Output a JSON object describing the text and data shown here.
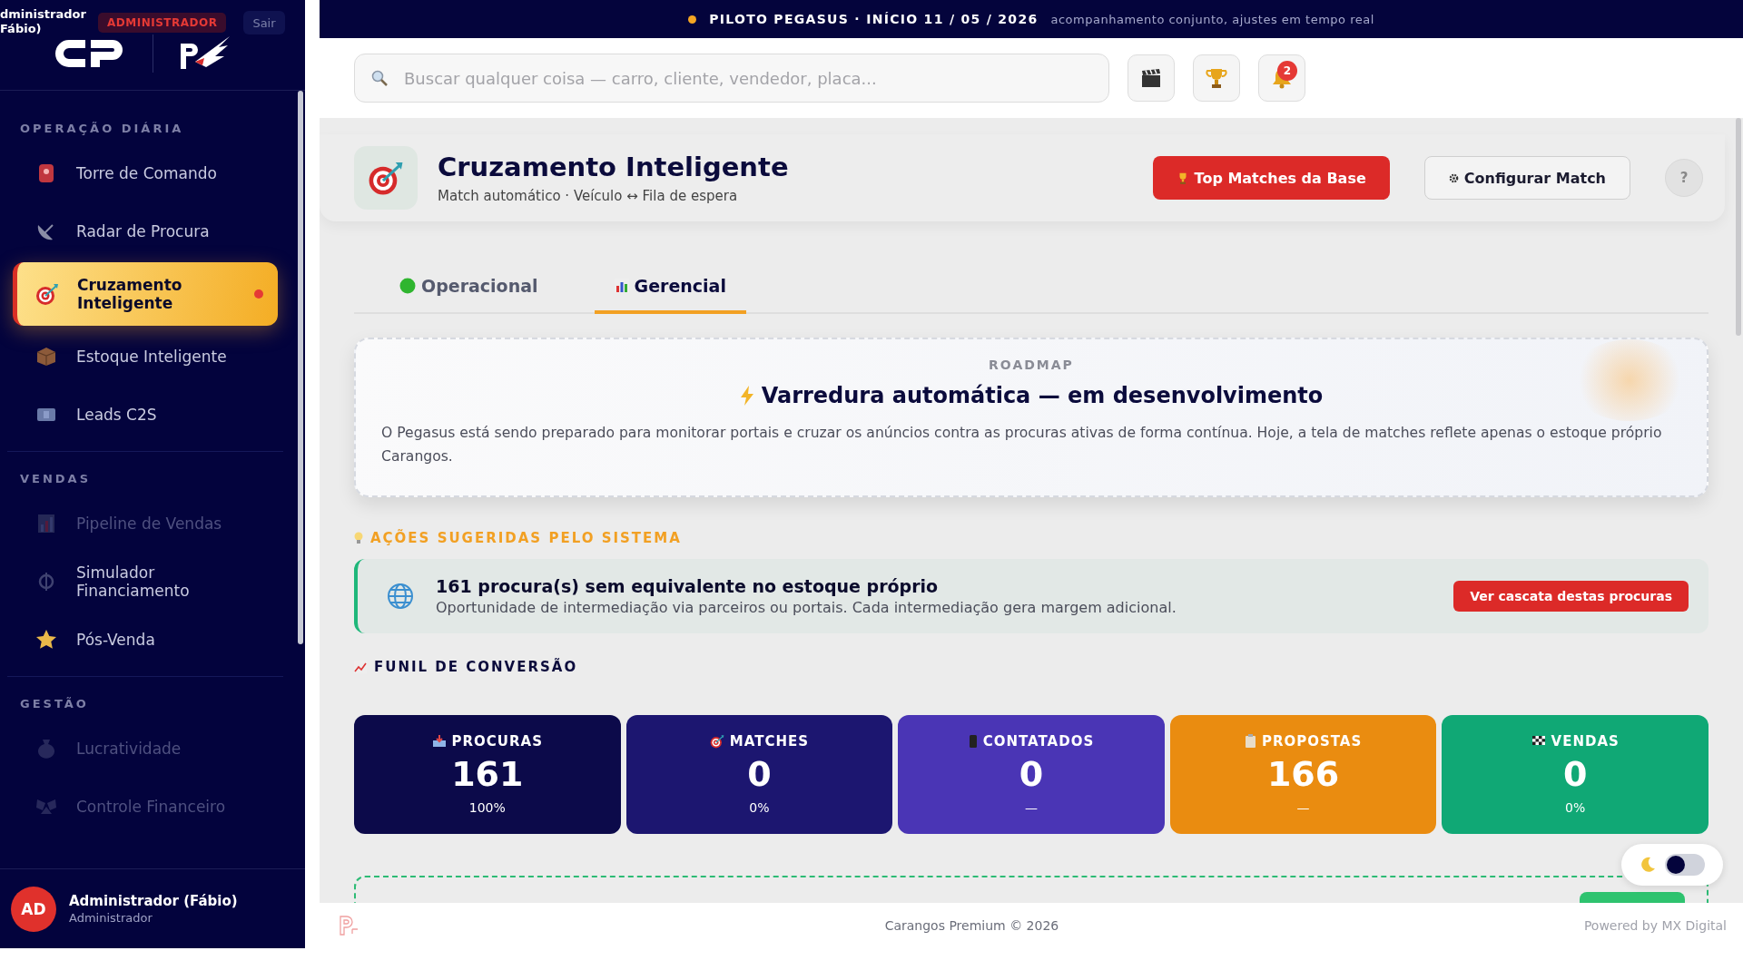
{
  "sidebar": {
    "user_cut": "dministrador Fábio)",
    "role_badge": "ADMINISTRADOR",
    "logout": "Sair",
    "sections": [
      {
        "title": "OPERAÇÃO DIÁRIA",
        "items": [
          {
            "label": "Torre de Comando",
            "selected": false,
            "disabled": false,
            "alert": false
          },
          {
            "label": "Radar de Procura",
            "selected": false,
            "disabled": false,
            "alert": false
          },
          {
            "label": "Cruzamento Inteligente",
            "selected": true,
            "disabled": false,
            "alert": true
          },
          {
            "label": "Estoque Inteligente",
            "selected": false,
            "disabled": false,
            "alert": false
          },
          {
            "label": "Leads C2S",
            "selected": false,
            "disabled": false,
            "alert": false
          }
        ]
      },
      {
        "title": "VENDAS",
        "items": [
          {
            "label": "Pipeline de Vendas",
            "selected": false,
            "disabled": true,
            "alert": false
          },
          {
            "label": "Simulador Financiamento",
            "selected": false,
            "disabled": false,
            "alert": false
          },
          {
            "label": "Pós-Venda",
            "selected": false,
            "disabled": false,
            "alert": false
          }
        ]
      },
      {
        "title": "GESTÃO",
        "items": [
          {
            "label": "Lucratividade",
            "selected": false,
            "disabled": true,
            "alert": false
          },
          {
            "label": "Controle Financeiro",
            "selected": false,
            "disabled": true,
            "alert": false
          }
        ]
      }
    ],
    "account": {
      "initials": "AD",
      "name": "Administrador (Fábio)",
      "role": "Administrador"
    }
  },
  "banner": {
    "title": "PILOTO PEGASUS · INÍCIO 11 / 05 / 2026",
    "subtitle": "acompanhamento conjunto, ajustes em tempo real"
  },
  "search": {
    "placeholder": "Buscar qualquer coisa — carro, cliente, vendedor, placa..."
  },
  "notifications": {
    "count": "2"
  },
  "header": {
    "title": "Cruzamento Inteligente",
    "subtitle": "Match automático · Veículo ↔ Fila de espera",
    "primary_button": "Top Matches da Base",
    "secondary_button": "Configurar Match",
    "help": "?"
  },
  "tabs": [
    {
      "label": "Operacional",
      "selected": false
    },
    {
      "label": "Gerencial",
      "selected": true
    }
  ],
  "roadmap": {
    "eyebrow": "ROADMAP",
    "title": "Varredura automática — em desenvolvimento",
    "text": "O Pegasus está sendo preparado para monitorar portais e cruzar os anúncios contra as procuras ativas de forma contínua. Hoje, a tela de matches reflete apenas o estoque próprio Carangos."
  },
  "suggestions": {
    "title": "AÇÕES SUGERIDAS PELO SISTEMA",
    "items": [
      {
        "title": "161 procura(s) sem equivalente no estoque próprio",
        "text": "Oportunidade de intermediação via parceiros ou portais. Cada intermediação gera margem adicional.",
        "action": "Ver cascata destas procuras"
      }
    ]
  },
  "funnel": {
    "title": "FUNIL DE CONVERSÃO",
    "stages": [
      {
        "label": "PROCURAS",
        "value": "161",
        "share": "100%",
        "color": "#0c0a4a"
      },
      {
        "label": "MATCHES",
        "value": "0",
        "share": "0%",
        "color": "#1c1670"
      },
      {
        "label": "CONTATADOS",
        "value": "0",
        "share": "—",
        "color": "#4a35b5"
      },
      {
        "label": "PROPOSTAS",
        "value": "166",
        "share": "—",
        "color": "#ea8c10"
      },
      {
        "label": "VENDAS",
        "value": "0",
        "share": "0%",
        "color": "#10a875"
      }
    ]
  },
  "theme_toggle": {
    "on": false
  },
  "footer": {
    "copyright": "Carangos Premium © 2026",
    "credit": "Powered by MX Digital"
  }
}
